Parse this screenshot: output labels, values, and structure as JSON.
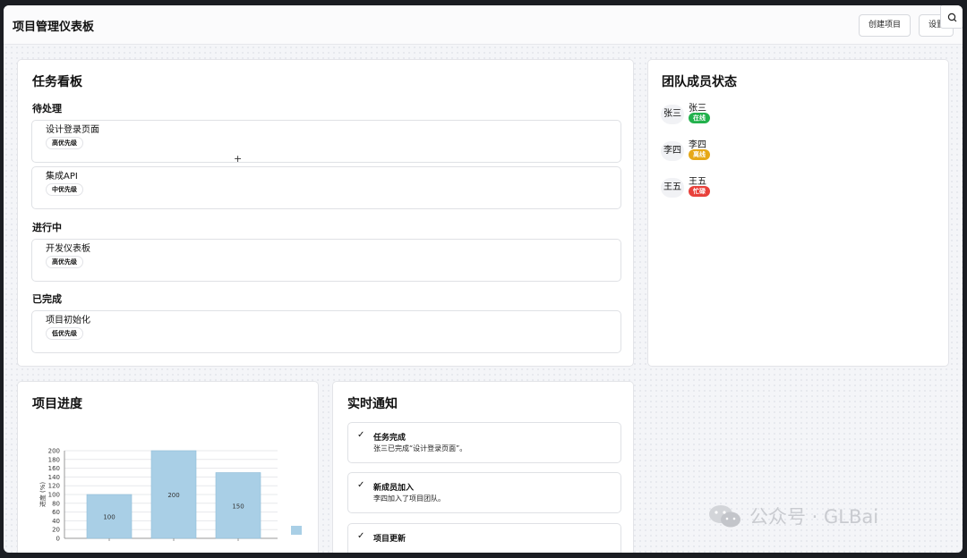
{
  "header": {
    "title": "项目管理仪表板",
    "create_label": "创建项目",
    "settings_label": "设置"
  },
  "kanban": {
    "title": "任务看板",
    "columns": [
      {
        "title": "待处理",
        "tasks": [
          {
            "name": "设计登录页面",
            "priority": "高优先级"
          },
          {
            "name": "集成API",
            "priority": "中优先级"
          }
        ]
      },
      {
        "title": "进行中",
        "tasks": [
          {
            "name": "开发仪表板",
            "priority": "高优先级"
          }
        ]
      },
      {
        "title": "已完成",
        "tasks": [
          {
            "name": "项目初始化",
            "priority": "低优先级"
          }
        ]
      }
    ]
  },
  "team": {
    "title": "团队成员状态",
    "members": [
      {
        "avatar": "张三",
        "name": "张三",
        "status": "在线",
        "color": "#22b14c"
      },
      {
        "avatar": "李四",
        "name": "李四",
        "status": "离线",
        "color": "#e6a817"
      },
      {
        "avatar": "王五",
        "name": "王五",
        "status": "忙碌",
        "color": "#e8413b"
      }
    ]
  },
  "progress": {
    "title": "项目进度"
  },
  "chart_data": {
    "type": "bar",
    "categories": [
      "",
      "",
      ""
    ],
    "values": [
      100,
      200,
      150
    ],
    "value_labels": [
      "100",
      "200",
      "150"
    ],
    "ylabel": "进度 (%)",
    "ylim": [
      0,
      200
    ],
    "yticks": [
      "0",
      "20",
      "40",
      "60",
      "80",
      "100",
      "120",
      "140",
      "160",
      "180",
      "200"
    ],
    "bar_color": "#a9cfe6",
    "grid": true,
    "legend": "right"
  },
  "notifications": {
    "title": "实时通知",
    "items": [
      {
        "title": "任务完成",
        "text": "张三已完成“设计登录页面”。"
      },
      {
        "title": "新成员加入",
        "text": "李四加入了项目团队。"
      },
      {
        "title": "项目更新",
        "text": ""
      }
    ]
  },
  "watermark": {
    "text": "公众号 · GLBai"
  }
}
